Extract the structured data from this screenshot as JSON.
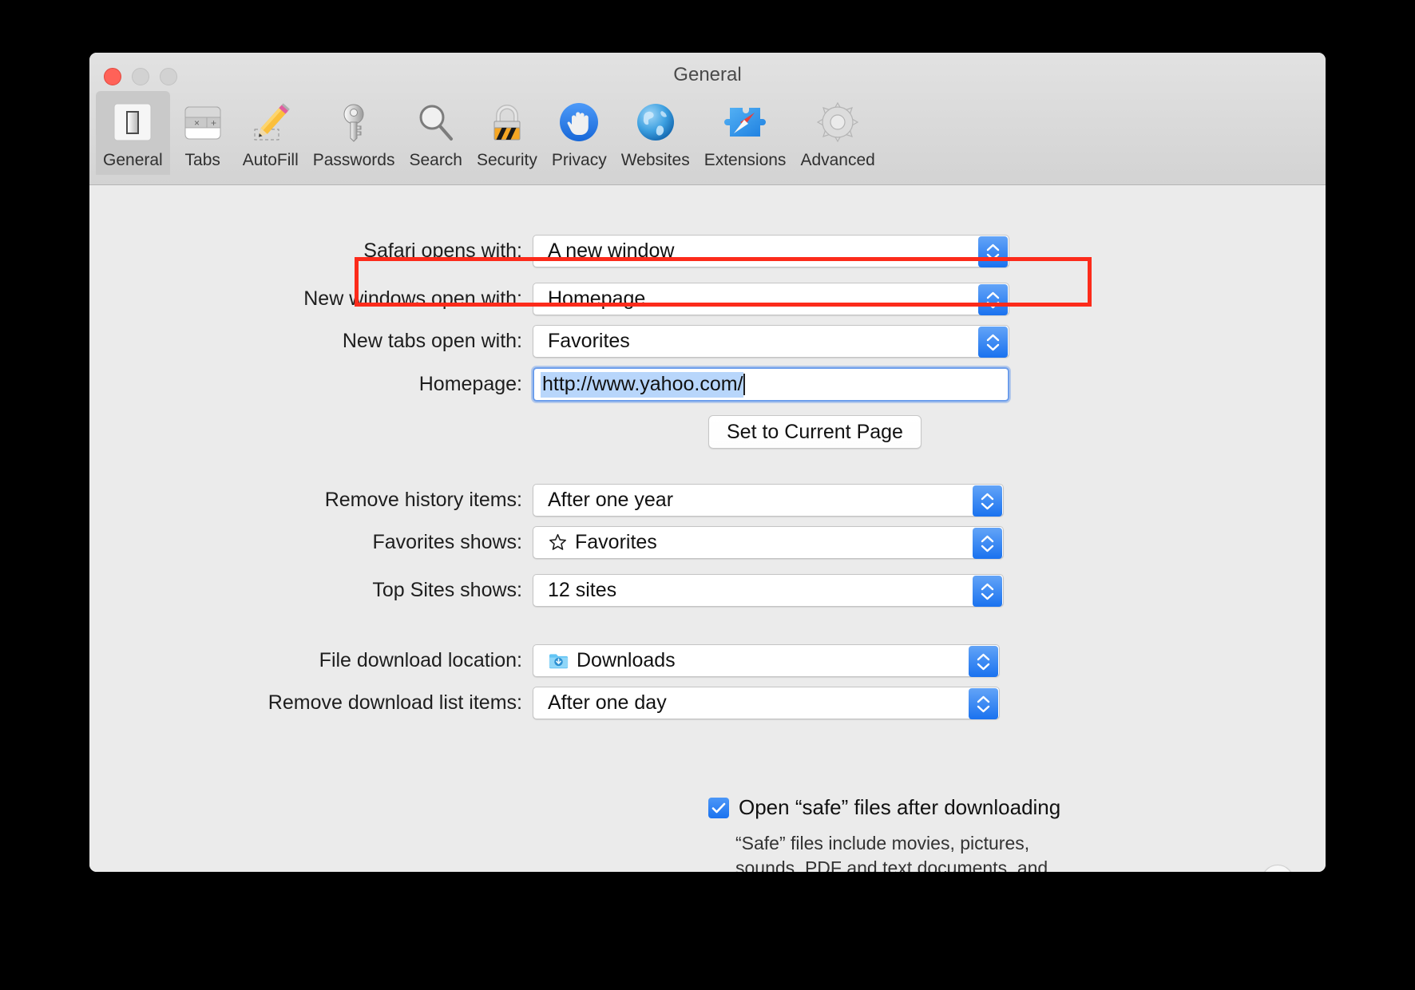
{
  "window": {
    "title": "General",
    "traffic_lights": [
      "close",
      "minimize",
      "zoom"
    ]
  },
  "toolbar": {
    "tabs": [
      {
        "label": "General",
        "icon": "toggle-switch-icon",
        "selected": true
      },
      {
        "label": "Tabs",
        "icon": "browser-tabs-icon",
        "selected": false
      },
      {
        "label": "AutoFill",
        "icon": "pencil-icon",
        "selected": false
      },
      {
        "label": "Passwords",
        "icon": "key-icon",
        "selected": false
      },
      {
        "label": "Search",
        "icon": "magnifier-icon",
        "selected": false
      },
      {
        "label": "Security",
        "icon": "padlock-icon",
        "selected": false
      },
      {
        "label": "Privacy",
        "icon": "hand-icon",
        "selected": false
      },
      {
        "label": "Websites",
        "icon": "globe-icon",
        "selected": false
      },
      {
        "label": "Extensions",
        "icon": "puzzle-compass-icon",
        "selected": false
      },
      {
        "label": "Advanced",
        "icon": "gear-icon",
        "selected": false
      }
    ]
  },
  "form": {
    "safari_opens_with": {
      "label": "Safari opens with:",
      "value": "A new window"
    },
    "new_windows_open_with": {
      "label": "New windows open with:",
      "value": "Homepage"
    },
    "new_tabs_open_with": {
      "label": "New tabs open with:",
      "value": "Favorites"
    },
    "homepage": {
      "label": "Homepage:",
      "value": "http://www.yahoo.com/",
      "placeholder": ""
    },
    "set_to_current_page": {
      "label": "Set to Current Page"
    },
    "remove_history_items": {
      "label": "Remove history items:",
      "value": "After one year"
    },
    "favorites_shows": {
      "label": "Favorites shows:",
      "value": "Favorites",
      "icon": "star-icon"
    },
    "top_sites_shows": {
      "label": "Top Sites shows:",
      "value": "12 sites"
    },
    "file_download_location": {
      "label": "File download location:",
      "value": "Downloads",
      "icon": "downloads-folder-icon"
    },
    "remove_download_items": {
      "label": "Remove download list items:",
      "value": "After one day"
    },
    "open_safe_files": {
      "label": "Open “safe” files after downloading",
      "checked": true
    },
    "safe_files_help": "“Safe” files include movies, pictures, sounds, PDF and text documents, and archives."
  },
  "help_button": {
    "label": "?"
  },
  "annotation": {
    "type": "highlight-rectangle",
    "color": "#fc2b1b",
    "targets": "new_windows_open_with"
  },
  "colors": {
    "window_bg": "#ebebeb",
    "toolbar_bg": "#d8d8d8",
    "accent_blue": "#1a72ef",
    "selection_blue": "#b8d6fb",
    "highlight_red": "#fc2b1b"
  }
}
